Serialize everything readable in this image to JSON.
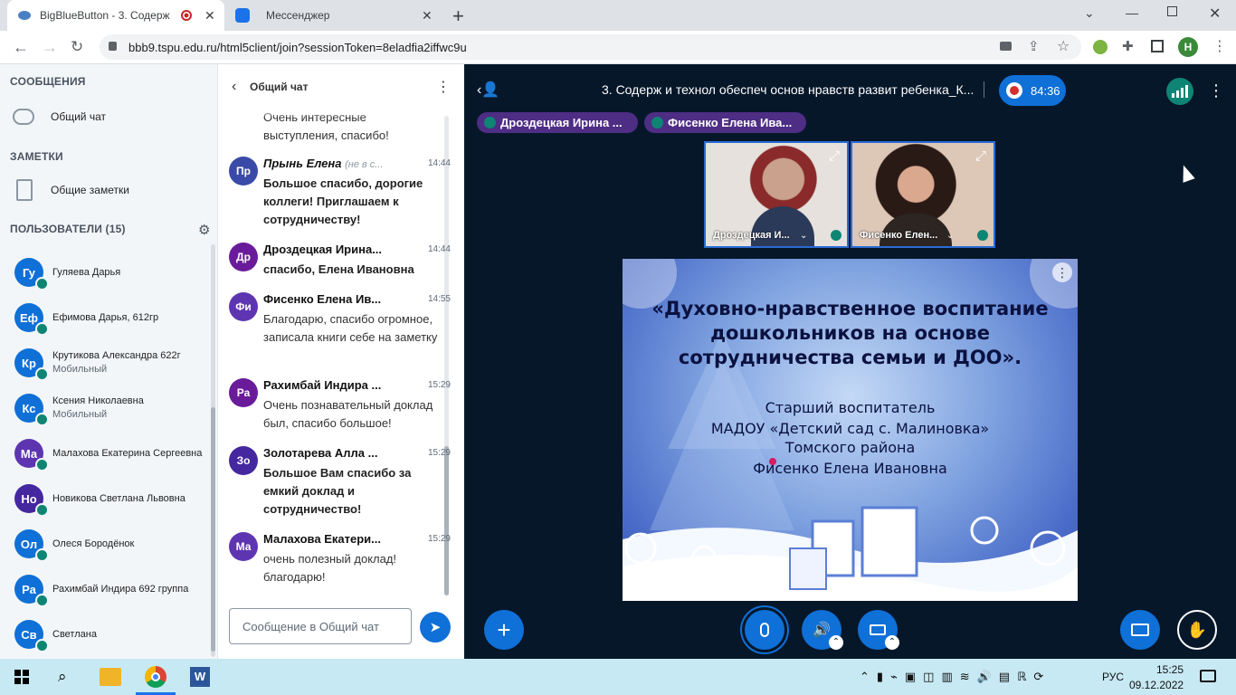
{
  "browser": {
    "tabs": [
      {
        "title": "BigBlueButton - 3. Содерж",
        "active": true
      },
      {
        "title": "Мессенджер",
        "active": false
      }
    ],
    "url": "bbb9.tspu.edu.ru/html5client/join?sessionToken=8eladfia2iffwc9u",
    "profile_initial": "H"
  },
  "sidebar": {
    "messages_title": "СООБЩЕНИЯ",
    "public_chat_label": "Общий чат",
    "notes_title": "ЗАМЕТКИ",
    "shared_notes_label": "Общие заметки",
    "users_title": "ПОЛЬЗОВАТЕЛИ (15)",
    "users": [
      {
        "initials": "Гу",
        "name": "Гуляева Дарья",
        "sub": "",
        "color": "#0f70d7"
      },
      {
        "initials": "Еф",
        "name": "Ефимова Дарья, 612гр",
        "sub": "",
        "color": "#0f70d7"
      },
      {
        "initials": "Кр",
        "name": "Крутикова Александра 622г",
        "sub": "Мобильный",
        "color": "#0f70d7"
      },
      {
        "initials": "Кс",
        "name": "Ксения Николаевна",
        "sub": "Мобильный",
        "color": "#0f70d7"
      },
      {
        "initials": "Ма",
        "name": "Малахова Екатерина Сергеевна",
        "sub": "",
        "color": "#5e35b1"
      },
      {
        "initials": "Но",
        "name": "Новикова Светлана Львовна",
        "sub": "",
        "color": "#4527a0"
      },
      {
        "initials": "Ол",
        "name": "Олеся Бородёнок",
        "sub": "",
        "color": "#0f70d7"
      },
      {
        "initials": "Ра",
        "name": "Рахимбай Индира 692 группа",
        "sub": "",
        "color": "#0f70d7"
      },
      {
        "initials": "Св",
        "name": "Светлана",
        "sub": "",
        "color": "#0f70d7"
      }
    ]
  },
  "chat": {
    "title": "Общий чат",
    "input_placeholder": "Сообщение в Общий чат",
    "partial_message": "Очень интересные выступления, спасибо!",
    "messages": [
      {
        "initials": "Пр",
        "name": "Прынь Елена",
        "note": "(не в с...",
        "time": "14:44",
        "text": "Большое спасибо, дорогие коллеги! Приглашаем к сотрудничеству!",
        "color": "#3a4aa8",
        "bold": true
      },
      {
        "initials": "Др",
        "name": "Дроздецкая Ирина...",
        "note": "",
        "time": "14:44",
        "text": "спасибо, Елена Ивановна",
        "color": "#6a1b9a",
        "bold": true
      },
      {
        "initials": "Фи",
        "name": "Фисенко Елена Ив...",
        "note": "",
        "time": "14:55",
        "text": "Благодарю, спасибо огромное, записала книги себе на заметку",
        "color": "#5e35b1",
        "bold": false
      },
      {
        "initials": "Ра",
        "name": "Рахимбай Индира ...",
        "note": "",
        "time": "15:29",
        "text": "Очень познавательный доклад был, спасибо большое!",
        "color": "#6a1b9a",
        "bold": false
      },
      {
        "initials": "Зо",
        "name": "Золотарева Алла ...",
        "note": "",
        "time": "15:29",
        "text": "Большое Вам спасибо за емкий доклад и сотрудничество!",
        "color": "#4527a0",
        "bold": true
      },
      {
        "initials": "Ма",
        "name": "Малахова Екатери...",
        "note": "",
        "time": "15:29",
        "text": "очень полезный доклад! благодарю!",
        "color": "#5e35b1",
        "bold": false
      }
    ]
  },
  "meeting": {
    "title": "3. Содерж и технол обеспеч основ нравств развит ребенка_К...",
    "recording_time": "84:36",
    "talkers": [
      "Дроздецкая Ирина ...",
      "Фисенко Елена Ива..."
    ],
    "videos": [
      {
        "label": "Дроздецкая И..."
      },
      {
        "label": "Фисенко Елен..."
      }
    ]
  },
  "slide": {
    "title": "«Духовно-нравственное воспитание дошкольников на основе сотрудничества семьи и ДОО».",
    "line1": "Старший воспитатель",
    "line2": "МАДОУ «Детский сад с. Малиновка»",
    "line3": "Томского района",
    "line4": "Фисенко Елена Ивановна"
  },
  "taskbar": {
    "lang": "РУС",
    "time": "15:25",
    "date": "09.12.2022"
  },
  "colors": {
    "bbb_blue": "#0f70d7",
    "talker_purple": "#4e2d85",
    "mic_green": "#0e8574",
    "main_bg": "#06172a"
  }
}
